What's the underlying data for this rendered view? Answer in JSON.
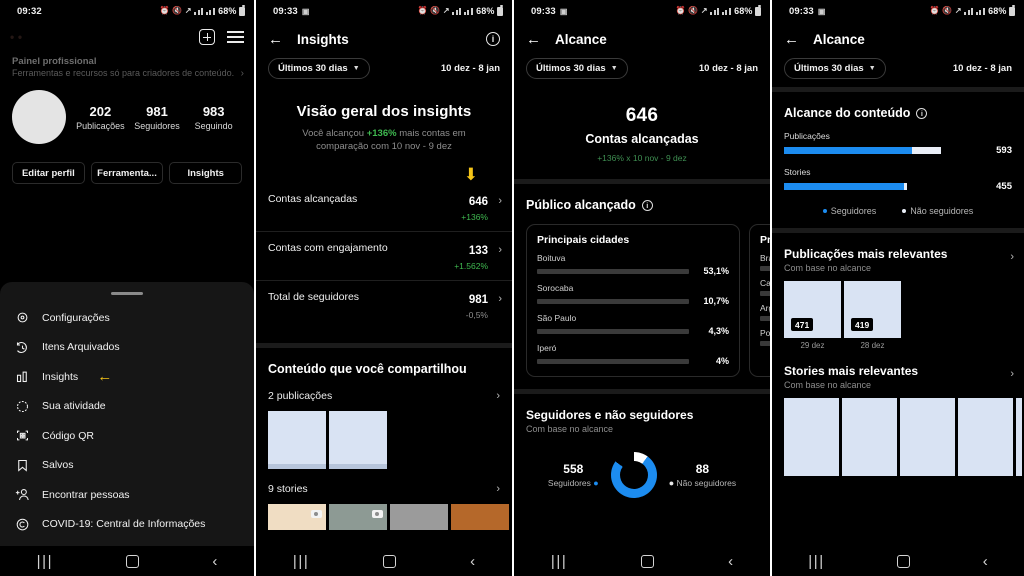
{
  "status_bar": {
    "time_p1": "09:32",
    "time_others": "09:33",
    "battery": "68%",
    "icons": [
      "alarm-icon",
      "mute-icon",
      "wifi-icon",
      "signal-icon",
      "signal-icon",
      "battery-icon"
    ]
  },
  "nav_bar": {
    "recents": "|||",
    "home": "home-square-icon",
    "back": "‹"
  },
  "panel1": {
    "username": "• •",
    "pro_panel": {
      "title": "Painel profissional",
      "subtitle": "Ferramentas e recursos só para criadores de conteúdo.",
      "chevron": "›"
    },
    "stats": [
      {
        "value": "202",
        "label": "Publicações"
      },
      {
        "value": "981",
        "label": "Seguidores"
      },
      {
        "value": "983",
        "label": "Seguindo"
      }
    ],
    "buttons": [
      "Editar perfil",
      "Ferramenta...",
      "Insights"
    ],
    "menu": [
      {
        "label": "Configurações",
        "icon": "gear-icon",
        "highlight": false
      },
      {
        "label": "Itens Arquivados",
        "icon": "archive-clock-icon",
        "highlight": false
      },
      {
        "label": "Insights",
        "icon": "bar-chart-icon",
        "highlight": true
      },
      {
        "label": "Sua atividade",
        "icon": "activity-clock-icon",
        "highlight": false
      },
      {
        "label": "Código QR",
        "icon": "qr-code-icon",
        "highlight": false
      },
      {
        "label": "Salvos",
        "icon": "bookmark-icon",
        "highlight": false
      },
      {
        "label": "Encontrar pessoas",
        "icon": "add-person-icon",
        "highlight": false
      },
      {
        "label": "COVID-19: Central de Informações",
        "icon": "covid-info-icon",
        "highlight": false
      }
    ],
    "highlight_arrow": "←"
  },
  "panel2": {
    "header": {
      "title": "Insights",
      "back": "←",
      "info": "i"
    },
    "date_chip": "Últimos 30 dias",
    "chevron_down": "⌄",
    "date_range": "10 dez - 8 jan",
    "overview": {
      "title": "Visão geral dos insights",
      "sub_pre": "Você alcançou ",
      "sub_pct": "+136%",
      "sub_post": " mais contas em comparação com 10 nov - 9 dez",
      "down_arrow": "⬇"
    },
    "rows": [
      {
        "label": "Contas alcançadas",
        "value": "646",
        "delta": "+136%",
        "dir": "up",
        "chevron": "›"
      },
      {
        "label": "Contas com engajamento",
        "value": "133",
        "delta": "+1.562%",
        "dir": "up",
        "chevron": "›"
      },
      {
        "label": "Total de seguidores",
        "value": "981",
        "delta": "-0,5%",
        "dir": "down",
        "chevron": "›"
      }
    ],
    "shared": {
      "title": "Conteúdo que você compartilhou",
      "posts_label": "2 publicações",
      "posts_chevron": "›",
      "stories_label": "9 stories",
      "stories_chevron": "›",
      "post_thumbs": [
        "#d9e3f3",
        "#d9e3f3"
      ],
      "story_thumbs": [
        "#f0ddc3",
        "#8d9a94",
        "#9b9b9b",
        "#b5682a"
      ]
    }
  },
  "panel3": {
    "header": {
      "title": "Alcance",
      "back": "←"
    },
    "date_chip": "Últimos 30 dias",
    "chevron_down": "⌄",
    "date_range": "10 dez - 8 jan",
    "hero": {
      "value": "646",
      "label": "Contas alcançadas",
      "delta": "+136% x 10 nov - 9 dez"
    },
    "audience": {
      "title": "Público alcançado",
      "info": "i"
    },
    "cards": [
      {
        "title": "Principais cidades",
        "items": [
          {
            "label": "Boituva",
            "value": "53,1%",
            "pct": 53.1
          },
          {
            "label": "Sorocaba",
            "value": "10,7%",
            "pct": 10.7
          },
          {
            "label": "São Paulo",
            "value": "4,3%",
            "pct": 4.3
          },
          {
            "label": "Iperó",
            "value": "4%",
            "pct": 4
          }
        ]
      },
      {
        "title": "Principais países",
        "items": [
          {
            "label": "Brasil",
            "value": "",
            "pct": 96
          },
          {
            "label": "Canadá",
            "value": "",
            "pct": 18
          },
          {
            "label": "Argentina",
            "value": "",
            "pct": 3
          },
          {
            "label": "Portugal",
            "value": "",
            "pct": 3
          }
        ]
      }
    ],
    "followers_block": {
      "title": "Seguidores e não seguidores",
      "subtitle": "Com base no alcance",
      "left_value": "558",
      "left_label": "Seguidores",
      "right_value": "88",
      "right_label": "Não seguidores"
    }
  },
  "panel4": {
    "header": {
      "title": "Alcance",
      "back": "←"
    },
    "date_chip": "Últimos 30 dias",
    "chevron_down": "⌄",
    "date_range": "10 dez - 8 jan",
    "content_reach": {
      "title": "Alcance do conteúdo",
      "info": "i",
      "bars": [
        {
          "label": "Publicações",
          "value": "593",
          "blue_pct": 80,
          "light_pct": 18
        },
        {
          "label": "Stories",
          "value": "455",
          "blue_pct": 75,
          "light_pct": 2
        }
      ],
      "legend": [
        {
          "label": "Seguidores",
          "color": "#1c8cf0"
        },
        {
          "label": "Não seguidores",
          "color": "#e9eef7"
        }
      ]
    },
    "top_posts": {
      "title": "Publicações mais relevantes",
      "subtitle": "Com base no alcance",
      "chevron": "›",
      "items": [
        {
          "badge": "471",
          "caption": "29 dez"
        },
        {
          "badge": "419",
          "caption": "28 dez"
        }
      ]
    },
    "top_stories": {
      "title": "Stories mais relevantes",
      "subtitle": "Com base no alcance",
      "chevron": "›",
      "count": 5
    }
  },
  "theme": {
    "accent_blue": "#1c8cf0",
    "positive_green": "#3fb950",
    "highlight_yellow": "#f5c518",
    "thumb_placeholder": "#d9e3f3",
    "background": "#000000",
    "sheet_background": "#161616"
  }
}
